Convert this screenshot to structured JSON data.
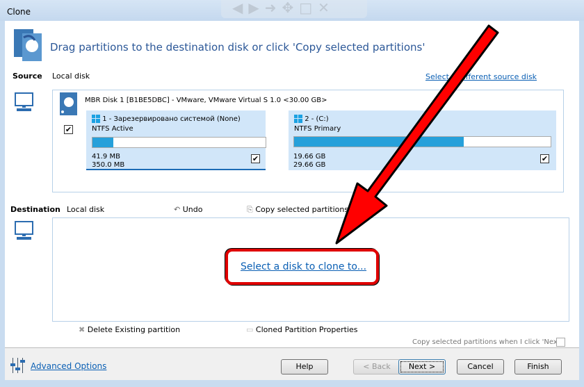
{
  "window": {
    "title": "Clone"
  },
  "header": {
    "instruction": "Drag partitions to the destination disk or click 'Copy selected partitions'"
  },
  "source": {
    "label": "Source",
    "type": "Local disk",
    "change_link": "Select a different source disk",
    "disk": {
      "name": "MBR Disk 1 [B1BE5DBC] - VMware,  VMware Virtual S 1.0  <30.00 GB>",
      "checked": true
    },
    "partitions": [
      {
        "title": "1 - Зарезервировано системой (None)",
        "fs": "NTFS Active",
        "used": "41.9 MB",
        "total": "350.0 MB",
        "used_pct": 12,
        "checked": true
      },
      {
        "title": "2 -  (C:)",
        "fs": "NTFS Primary",
        "used": "19.66 GB",
        "total": "29.66 GB",
        "used_pct": 66,
        "checked": true
      }
    ]
  },
  "destination": {
    "label": "Destination",
    "type": "Local disk",
    "undo": "Undo",
    "copy_selected": "Copy selected partitions",
    "select_link": "Select a disk to clone to..."
  },
  "actions": {
    "delete": "Delete Existing partition",
    "properties": "Cloned Partition Properties",
    "copy_on_next": "Copy selected partitions when I click 'Next'",
    "copy_on_next_checked": false
  },
  "footer": {
    "advanced": "Advanced Options",
    "help": "Help",
    "back": "< Back",
    "next": "Next >",
    "cancel": "Cancel",
    "finish": "Finish"
  },
  "colors": {
    "accent": "#26a0da",
    "annotation": "#ff0000"
  }
}
